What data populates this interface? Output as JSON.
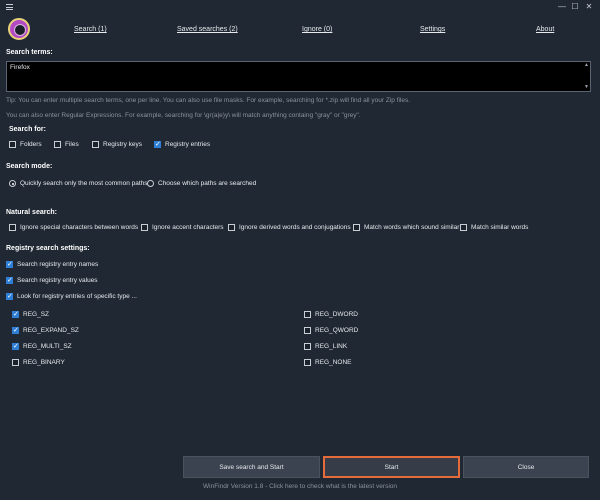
{
  "window": {
    "minimize": "—",
    "maximize": "☐",
    "close": "✕"
  },
  "nav": {
    "search": "Search (1)",
    "saved_searches": "Saved searches (2)",
    "ignore": "Ignore (0)",
    "settings": "Settings",
    "about": "About"
  },
  "search_terms": {
    "label": "Search terms:",
    "value": "Firefox",
    "tip1": "Tip: You can enter multiple search terms, one per line. You can also use file masks. For example, searching for *.zip will find all your Zip files.",
    "tip2": "You can also enter Regular Expressions. For example, searching for \\gr(a|e)y\\ will match anything containg \"gray\" or \"grey\"."
  },
  "search_for": {
    "label": "Search for:",
    "options": [
      {
        "label": "Folders",
        "checked": false
      },
      {
        "label": "Files",
        "checked": false
      },
      {
        "label": "Registry keys",
        "checked": false
      },
      {
        "label": "Registry entries",
        "checked": true
      }
    ]
  },
  "search_mode": {
    "label": "Search mode:",
    "options": [
      {
        "label": "Quickly search only the most common paths",
        "selected": true
      },
      {
        "label": "Choose which paths are searched",
        "selected": false
      }
    ]
  },
  "natural_search": {
    "label": "Natural search:",
    "options": [
      {
        "label": "Ignore special characters between words",
        "checked": false
      },
      {
        "label": "Ignore accent characters",
        "checked": false
      },
      {
        "label": "Ignore derived words and conjugations",
        "checked": false
      },
      {
        "label": "Match words which sound similar",
        "checked": false
      },
      {
        "label": "Match similar words",
        "checked": false
      }
    ]
  },
  "registry": {
    "label": "Registry search settings:",
    "options": [
      {
        "label": "Search registry entry names",
        "checked": true
      },
      {
        "label": "Search registry entry values",
        "checked": true
      },
      {
        "label": "Look for registry entries of specific type ...",
        "checked": true
      }
    ],
    "types_left": [
      {
        "label": "REG_SZ",
        "checked": true
      },
      {
        "label": "REG_EXPAND_SZ",
        "checked": true
      },
      {
        "label": "REG_MULTI_SZ",
        "checked": true
      },
      {
        "label": "REG_BINARY",
        "checked": false
      }
    ],
    "types_right": [
      {
        "label": "REG_DWORD",
        "checked": false
      },
      {
        "label": "REG_QWORD",
        "checked": false
      },
      {
        "label": "REG_LINK",
        "checked": false
      },
      {
        "label": "REG_NONE",
        "checked": false
      }
    ]
  },
  "buttons": {
    "save_start": "Save search and Start",
    "start": "Start",
    "close": "Close"
  },
  "footer": "WinFindr Version 1.8 - Click here to check what is the latest version",
  "colors": {
    "background": "#202833",
    "accent": "#2f7fd6",
    "focus_border": "#e66b3a"
  }
}
